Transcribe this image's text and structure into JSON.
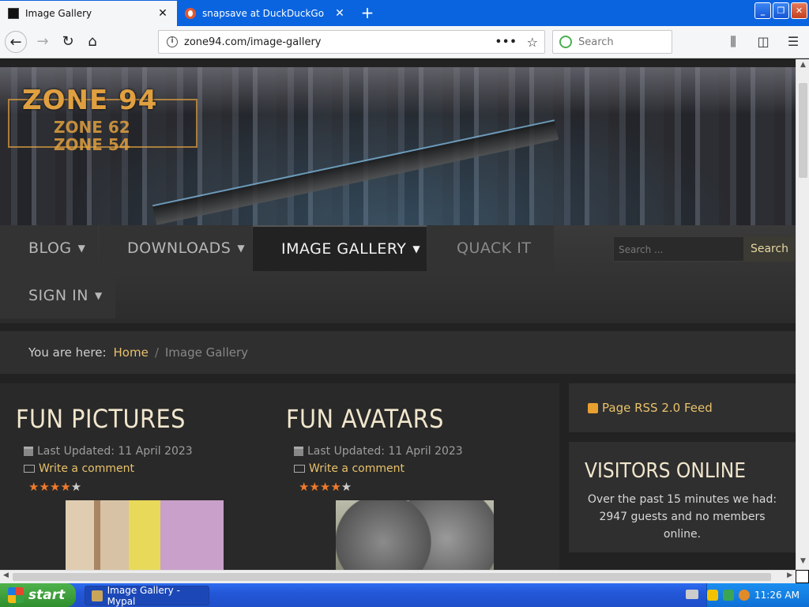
{
  "browser": {
    "tabs": [
      {
        "title": "Image Gallery",
        "active": true
      },
      {
        "title": "snapsave at DuckDuckGo",
        "active": false
      }
    ],
    "url": "zone94.com/image-gallery",
    "search_placeholder": "Search"
  },
  "site": {
    "logo": {
      "line1": "ZONE 94",
      "line2": "ZONE 62",
      "line3": "ZONE 54"
    },
    "menu": [
      {
        "label": "BLOG",
        "caret": "▼"
      },
      {
        "label": "DOWNLOADS",
        "caret": "▼"
      },
      {
        "label": "IMAGE GALLERY",
        "caret": "▼",
        "active": true
      },
      {
        "label": "QUACK IT"
      },
      {
        "label": "SIGN IN",
        "caret": "▼"
      }
    ],
    "search": {
      "placeholder": "Search ...",
      "button": "Search"
    },
    "breadcrumb": {
      "prefix": "You are here:",
      "home": "Home",
      "current": "Image Gallery"
    },
    "articles": [
      {
        "title": "FUN PICTURES",
        "updated": "Last Updated: 11 April 2023",
        "comment": "Write a comment",
        "rating": 4
      },
      {
        "title": "FUN AVATARS",
        "updated": "Last Updated: 11 April 2023",
        "comment": "Write a comment",
        "rating": 4.5
      }
    ],
    "sidebar": {
      "rss": "Page RSS 2.0 Feed",
      "visitors_title": "VISITORS ONLINE",
      "visitors_text": "Over the past 15 minutes we had: 2947 guests and no members online."
    }
  },
  "taskbar": {
    "start": "start",
    "task": "Image Gallery - Mypal",
    "clock": "11:26 AM"
  },
  "colors": {
    "accent": "#e8c26a",
    "star": "#f07a2a",
    "taskbar": "#2357d8"
  }
}
